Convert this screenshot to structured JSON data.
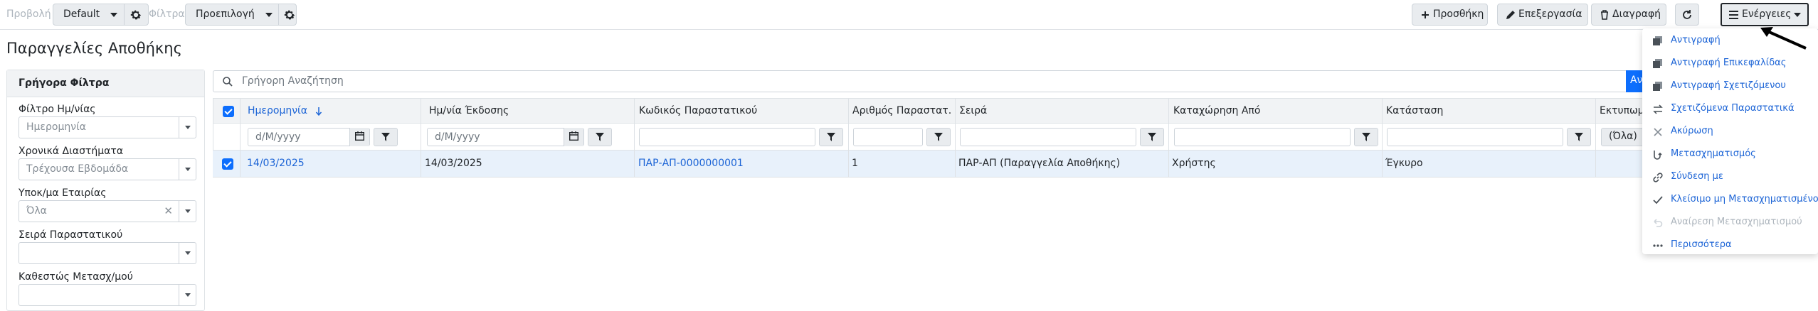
{
  "toolbar": {
    "view_label": "Προβολή",
    "view_value": "Default",
    "filters_label": "Φίλτρα",
    "filters_value": "Προεπιλογή",
    "add_label": "Προσθήκη",
    "edit_label": "Επεξεργασία",
    "delete_label": "Διαγραφή",
    "actions_label": "Ενέργειες"
  },
  "page": {
    "title": "Παραγγελίες Αποθήκης"
  },
  "quick_filters": {
    "title": "Γρήγορα Φίλτρα",
    "fields": [
      {
        "label": "Φίλτρο Ημ/νίας",
        "value": "Ημερομηνία"
      },
      {
        "label": "Χρονικά Διαστήματα",
        "value": "Τρέχουσα Εβδομάδα"
      },
      {
        "label": "Υποκ/μα Εταιρίας",
        "value": "Όλα"
      },
      {
        "label": "Σειρά Παραστατικού",
        "value": ""
      },
      {
        "label": "Καθεστώς Μετασχ/μού",
        "value": ""
      }
    ]
  },
  "search": {
    "placeholder": "Γρήγορη Αναζήτηση",
    "button_label": "Αν"
  },
  "grid": {
    "columns": [
      "Ημερομηνία",
      "Ημ/νία Έκδοσης",
      "Κωδικός Παραστατικού",
      "Αριθμός Παραστατ...",
      "Σειρά",
      "Καταχώρηση Από",
      "Κατάσταση",
      "Εκτυπωμ"
    ],
    "filter_placeholder_date": "d/M/yyyy",
    "filter_all_label": "(Όλα)",
    "rows": [
      {
        "date": "14/03/2025",
        "issue_date": "14/03/2025",
        "code": "ΠΑΡ-ΑΠ-0000000001",
        "number": "1",
        "series": "ΠΑΡ-ΑΠ (Παραγγελία Αποθήκης)",
        "created_by": "Χρήστης",
        "status": "Έγκυρο"
      }
    ]
  },
  "actions_menu": [
    {
      "label": "Αντιγραφή",
      "icon": "copy-icon",
      "enabled": true
    },
    {
      "label": "Αντιγραφή Επικεφαλίδας",
      "icon": "copy-header-icon",
      "enabled": true
    },
    {
      "label": "Αντιγραφή Σχετιζόμενου",
      "icon": "copy-related-icon",
      "enabled": true
    },
    {
      "label": "Σχετιζόμενα Παραστατικά",
      "icon": "swap-icon",
      "enabled": true
    },
    {
      "label": "Ακύρωση",
      "icon": "close-icon",
      "enabled": true
    },
    {
      "label": "Μετασχηματισμός",
      "icon": "transform-icon",
      "enabled": true
    },
    {
      "label": "Σύνδεση με",
      "icon": "link-icon",
      "enabled": true
    },
    {
      "label": "Κλείσιμο μη Μετασχηματισμένου",
      "icon": "check-icon",
      "enabled": true
    },
    {
      "label": "Αναίρεση Μετασχηματισμού",
      "icon": "undo-icon",
      "enabled": false
    },
    {
      "label": "Περισσότερα",
      "icon": "more-icon",
      "enabled": true
    }
  ],
  "colors": {
    "accent": "#0d6efd",
    "link": "#1c64d6",
    "selected_row": "#e8f1fb"
  }
}
